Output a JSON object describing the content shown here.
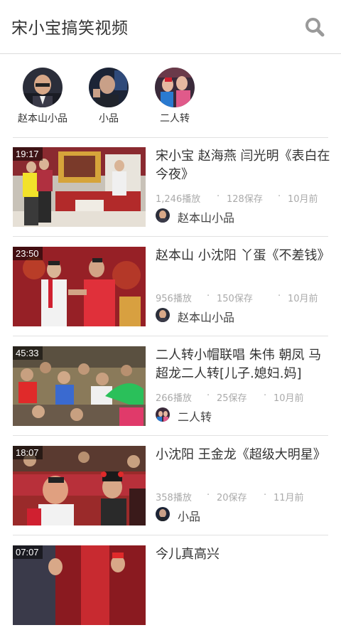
{
  "header": {
    "title": "宋小宝搞笑视频",
    "search_icon": "search-icon"
  },
  "channels": [
    {
      "name": "赵本山小品"
    },
    {
      "name": "小品"
    },
    {
      "name": "二人转"
    }
  ],
  "videos": [
    {
      "duration": "19:17",
      "title": "宋小宝 赵海燕 闫光明《表白在今夜》",
      "plays": "1,246播放",
      "saves": "128保存",
      "time": "10月前",
      "source": "赵本山小品"
    },
    {
      "duration": "23:50",
      "title": "赵本山 小沈阳 丫蛋《不差钱》",
      "plays": "956播放",
      "saves": "150保存",
      "time": "10月前",
      "source": "赵本山小品"
    },
    {
      "duration": "45:33",
      "title": "二人转小帽联唱 朱伟 朝凤 马超龙二人转[儿子.媳妇.妈]",
      "plays": "266播放",
      "saves": "25保存",
      "time": "10月前",
      "source": "二人转"
    },
    {
      "duration": "18:07",
      "title": "小沈阳 王金龙《超级大明星》",
      "plays": "358播放",
      "saves": "20保存",
      "time": "11月前",
      "source": "小品"
    },
    {
      "duration": "07:07",
      "title": "今儿真高兴"
    }
  ],
  "colors": {
    "accent_red": "#c8141e",
    "meta_gray": "#aaaaaa"
  }
}
